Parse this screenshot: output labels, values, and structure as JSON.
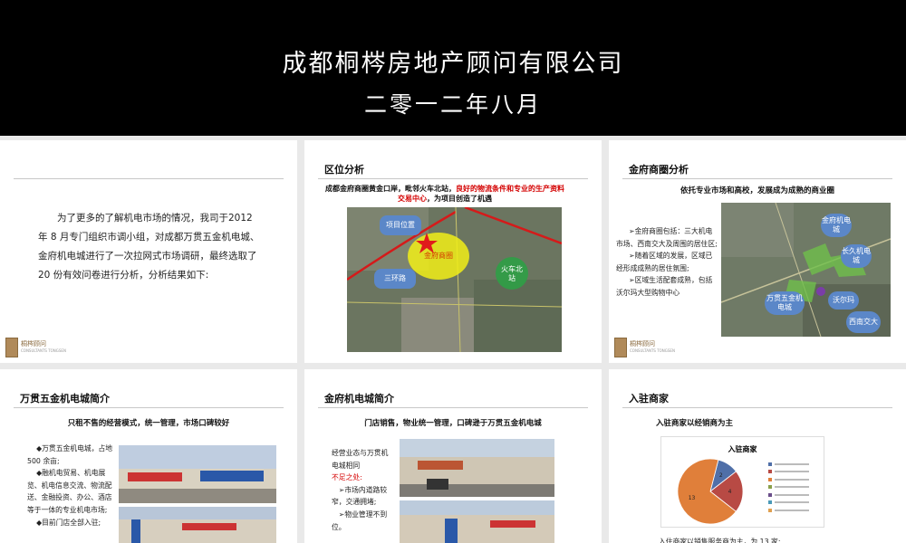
{
  "banner": {
    "company": "成都桐梣房地产顾问有限公司",
    "date": "二零一二年八月"
  },
  "logo": {
    "name": "桐梣顾问",
    "en": "CONSULTANTS TONGSEN"
  },
  "slide1": {
    "intro": "为了更多的了解机电市场的情况，我司于2012 年 8 月专门组织市调小组，对成都万贯五金机电城、金府机电城进行了一次拉网式市场调研，最终选取了 20 份有效问卷进行分析，分析结果如下:"
  },
  "slide2": {
    "title": "区位分析",
    "sub_black1": "成都金府商圈黄金口岸，毗邻火车北站，",
    "sub_red": "良好的物流条件和专业的生产资料交易中心",
    "sub_black2": "，为项目创造了机遇",
    "map_labels": {
      "project": "项目位置",
      "circle": "金府商圈",
      "ring": "三环路",
      "station": "火车北站"
    }
  },
  "slide3": {
    "title": "金府商圈分析",
    "sub": "依托专业市场和高校，发展成为成熟的商业圈",
    "bullets": [
      "➢金府商圈包括：三大机电市场、西南交大及周围的居住区;",
      "➢随着区域的发展，区域已经形成成熟的居住氛围;",
      "➢区域生活配套成熟，包括沃尔玛大型购物中心"
    ],
    "map_labels": {
      "jinfu": "金府机电城",
      "changjiu": "长久机电城",
      "wanguan": "万贯五金机电城",
      "walmart": "沃尔玛",
      "swjtu": "西南交大"
    }
  },
  "slide4": {
    "title": "万贯五金机电城简介",
    "sub": "只租不售的经营模式，统一管理，市场口碑较好",
    "bullets": [
      "◆万贯五金机电城，占地 500 余亩;",
      "◆融机电贸易、机电展览、机电信息交流、物流配送、金融投资、办公、酒店等于一体的专业机电市场;",
      "◆目前门店全部入驻;"
    ]
  },
  "slide5": {
    "title": "金府机电城简介",
    "sub": "门店销售，物业统一管理，口碑逊于万贯五金机电城",
    "line1": "经营业态与万贯机电城相同",
    "line2": "不足之处:",
    "bullets": [
      "➢市场内道路较窄，交通拥堵;",
      "➢物业管理不到位。"
    ]
  },
  "slide6": {
    "title": "入驻商家",
    "sub": "入驻商家以经销商为主",
    "chart_title": "入驻商家",
    "bottom_text": "入住商家以销售服务商为主，为 13 家;"
  },
  "chart_data": {
    "type": "pie",
    "title": "入驻商家",
    "values": [
      2,
      4,
      13
    ],
    "value_labels": [
      "2",
      "4",
      "13"
    ],
    "colors": [
      "#4f6fa8",
      "#b84a44",
      "#e07f3a",
      "#8aa04a",
      "#6a4e8a",
      "#4a9ab8",
      "#e0a050"
    ],
    "legend_position": "right"
  }
}
